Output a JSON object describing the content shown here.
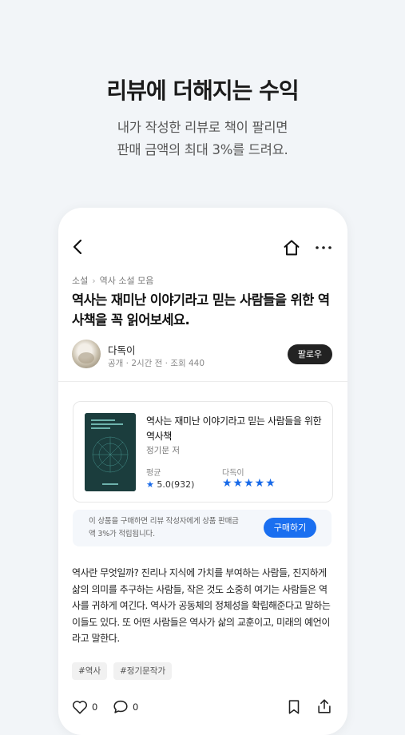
{
  "hero": {
    "title": "리뷰에 더해지는 수익",
    "subtitle_line1": "내가 작성한 리뷰로 책이 팔리면",
    "subtitle_line2": "판매 금액의 최대 3%를 드려요."
  },
  "topbar": {
    "back_icon": "chevron-left-icon",
    "home_icon": "home-icon",
    "more_icon": "more-horizontal-icon"
  },
  "post": {
    "breadcrumb": [
      "소설",
      "역사 소설 모음"
    ],
    "title": "역사는 재미난 이야기라고 믿는 사람들을 위한 역사책을 꼭 읽어보세요.",
    "author": {
      "name": "다독이",
      "meta": "공개 · 2시간 전 · 조회 440",
      "follow_label": "팔로우"
    },
    "body": "역사란 무엇일까? 진리나 지식에 가치를 부여하는 사람들, 진지하게 삶의 의미를 추구하는 사람들, 작은 것도 소중히 여기는 사람들은 역사를 귀하게 여긴다. 역사가 공동체의 정체성을 확립해준다고 말하는 이들도 있다. 또 어떤 사람들은 역사가 삶의 교훈이고, 미래의 예언이라고 말한다.",
    "tags": [
      "#역사",
      "#정기문작가"
    ]
  },
  "book": {
    "title": "역사는 재미난 이야기라고 믿는 사람들을 위한 역사책",
    "author": "정기문 저",
    "avg_label": "평균",
    "avg_value": "5.0(932)",
    "user_label": "다독이",
    "user_stars": "★★★★★",
    "user_rating": 5
  },
  "purchase": {
    "notice": "이 상품을 구매하면 리뷰 작성자에게 상품 판매금액 3%가 적립됩니다.",
    "button_label": "구매하기"
  },
  "actions": {
    "like_count": "0",
    "comment_count": "0"
  },
  "colors": {
    "accent": "#1a6ff0",
    "page_bg": "#f2f5f8",
    "follow_btn": "#222222"
  }
}
